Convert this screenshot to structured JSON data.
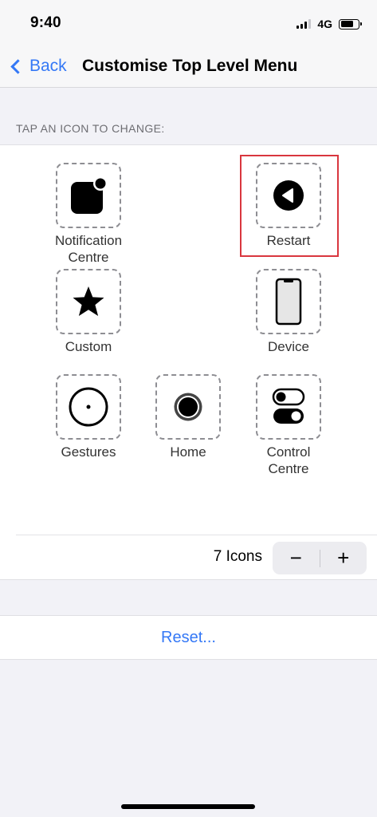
{
  "status": {
    "time": "9:40",
    "network": "4G"
  },
  "nav": {
    "back_label": "Back",
    "title": "Customise Top Level Menu"
  },
  "section_header": "TAP AN ICON TO CHANGE:",
  "slots": [
    {
      "label": "Notification\nCentre",
      "icon": "notification-centre-icon"
    },
    {
      "label": "Restart",
      "icon": "restart-icon",
      "highlighted": true
    },
    {
      "label": "Custom",
      "icon": "star-icon"
    },
    {
      "label": "Device",
      "icon": "device-icon"
    },
    {
      "label": "Gestures",
      "icon": "gestures-icon"
    },
    {
      "label": "Home",
      "icon": "home-icon"
    },
    {
      "label": "Control\nCentre",
      "icon": "control-centre-icon"
    }
  ],
  "count_label": "7 Icons",
  "stepper": {
    "minus": "−",
    "plus": "+"
  },
  "reset_label": "Reset...",
  "colors": {
    "accent": "#3478f6",
    "highlight": "#d9363e",
    "background": "#f2f2f7"
  }
}
